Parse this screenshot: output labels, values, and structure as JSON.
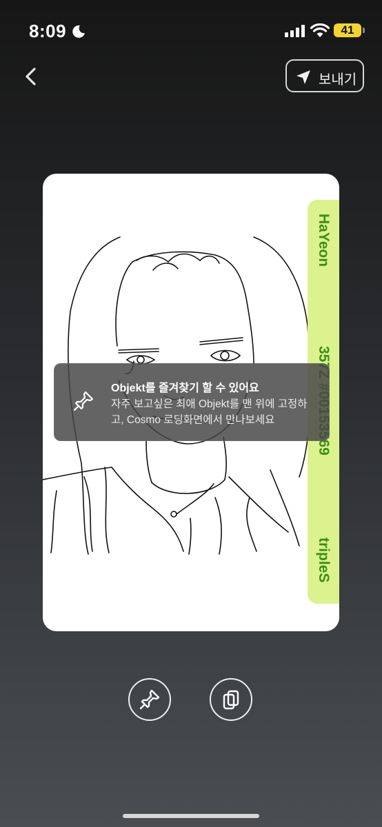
{
  "status_bar": {
    "time": "8:09",
    "battery": "41"
  },
  "header": {
    "send_label": "보내기"
  },
  "card": {
    "member": "HaYeon",
    "serial": "357Z #00153569",
    "group": "tripleS"
  },
  "toast": {
    "title": "Objekt를 즐겨찾기 할 수 있어요",
    "body": "자주 보고싶은 최애 Objekt를 맨 위에 고정하고, Cosmo 로딩화면에서 만나보세요"
  },
  "icons": [
    "moon-icon",
    "signal-icon",
    "wifi-icon",
    "battery-icon",
    "back-chevron-icon",
    "send-arrow-icon",
    "pin-icon",
    "copy-icon"
  ],
  "colors": {
    "accent_band": "#dcf28f",
    "band_text": "#3b8f16",
    "battery": "#f3d531"
  }
}
